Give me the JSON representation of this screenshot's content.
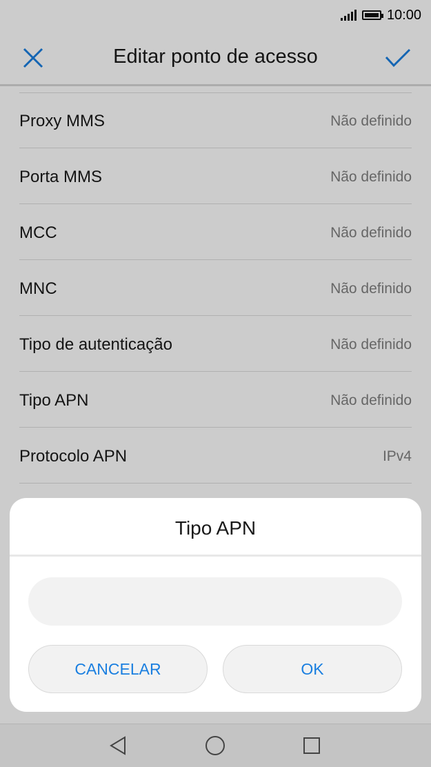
{
  "status_bar": {
    "time": "10:00"
  },
  "app_bar": {
    "title": "Editar ponto de acesso",
    "close_icon": "close-icon",
    "confirm_icon": "check-icon",
    "accent_color": "#1a7fe0"
  },
  "settings": {
    "rows": [
      {
        "label": "Proxy MMS",
        "value": "Não definido"
      },
      {
        "label": "Porta MMS",
        "value": "Não definido"
      },
      {
        "label": "MCC",
        "value": "Não definido"
      },
      {
        "label": "MNC",
        "value": "Não definido"
      },
      {
        "label": "Tipo de autenticação",
        "value": "Não definido"
      },
      {
        "label": "Tipo APN",
        "value": "Não definido"
      },
      {
        "label": "Protocolo APN",
        "value": "IPv4"
      }
    ]
  },
  "dialog": {
    "title": "Tipo APN",
    "input_value": "",
    "cancel_label": "CANCELAR",
    "ok_label": "OK"
  },
  "nav_bar": {
    "back_icon": "back-triangle-icon",
    "home_icon": "home-circle-icon",
    "recent_icon": "recent-square-icon"
  }
}
